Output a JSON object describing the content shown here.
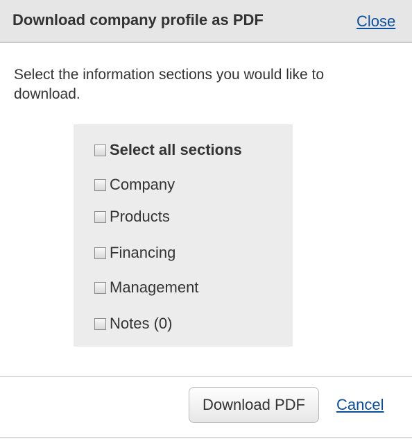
{
  "dialog": {
    "title": "Download company profile as PDF",
    "close_label": "Close",
    "intro_text": "Select the information sections you would like to download.",
    "sections": [
      {
        "label": "Select all sections",
        "checked": false
      },
      {
        "label": "Company",
        "checked": false
      },
      {
        "label": "Products",
        "checked": false
      },
      {
        "label": "Financing",
        "checked": false
      },
      {
        "label": "Management",
        "checked": false
      },
      {
        "label": "Notes (0)",
        "checked": false
      }
    ],
    "download_label": "Download PDF",
    "cancel_label": "Cancel"
  },
  "colors": {
    "header_background": "#e6e6e6",
    "section_background": "#ececec",
    "link": "#0b4f9c",
    "text": "#333333"
  },
  "icons": {
    "checkbox": "checkbox-icon"
  }
}
